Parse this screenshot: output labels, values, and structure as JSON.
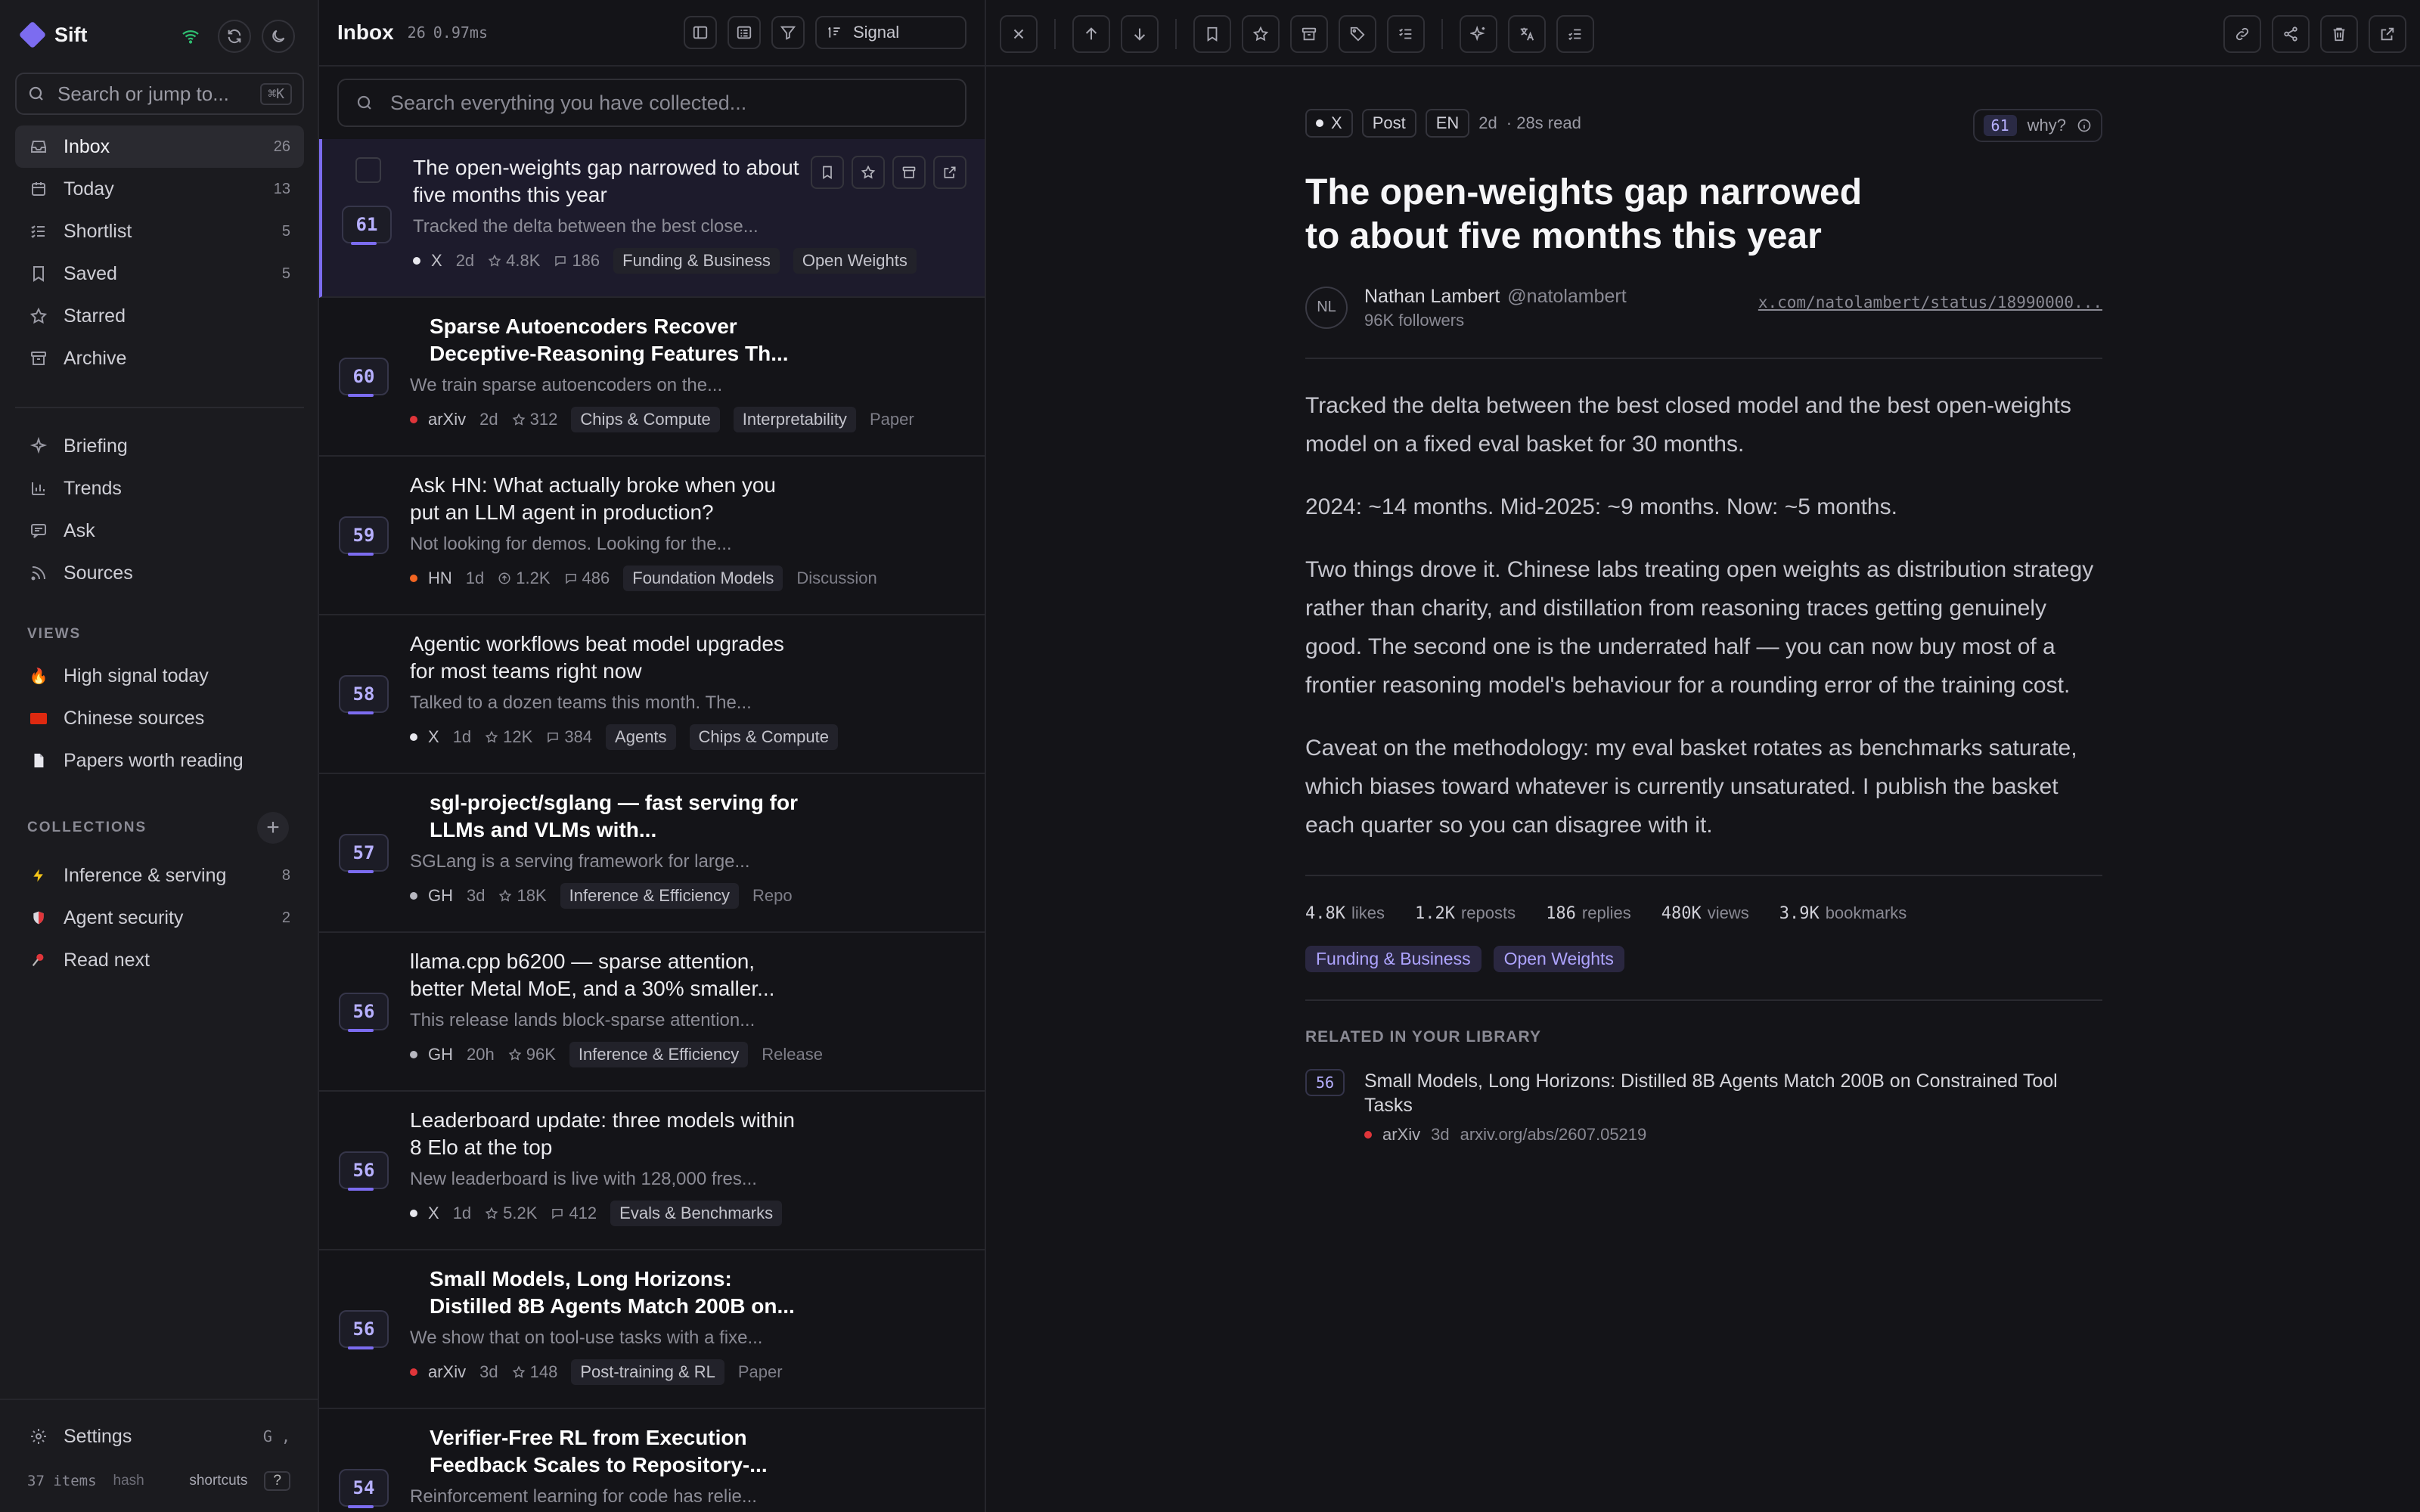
{
  "app": {
    "name": "Sift"
  },
  "sidebar": {
    "search_placeholder": "Search or jump to...",
    "search_kbd": "⌘K",
    "nav": [
      {
        "label": "Inbox",
        "count": "26",
        "icon": "inbox-icon"
      },
      {
        "label": "Today",
        "count": "13",
        "icon": "calendar-icon"
      },
      {
        "label": "Shortlist",
        "count": "5",
        "icon": "list-check-icon"
      },
      {
        "label": "Saved",
        "count": "5",
        "icon": "bookmark-icon"
      },
      {
        "label": "Starred",
        "count": "",
        "icon": "star-icon"
      },
      {
        "label": "Archive",
        "count": "",
        "icon": "archive-icon"
      }
    ],
    "tools": [
      {
        "label": "Briefing",
        "icon": "sparkle-icon"
      },
      {
        "label": "Trends",
        "icon": "bar-chart-icon"
      },
      {
        "label": "Ask",
        "icon": "chat-icon"
      },
      {
        "label": "Sources",
        "icon": "rss-icon"
      }
    ],
    "views_label": "VIEWS",
    "views": [
      {
        "label": "High signal today",
        "emoji": "🔥"
      },
      {
        "label": "Chinese sources",
        "emoji": "🇨🇳"
      },
      {
        "label": "Papers worth reading",
        "emoji": "📄"
      }
    ],
    "collections_label": "COLLECTIONS",
    "collections": [
      {
        "label": "Inference & serving",
        "count": "8",
        "emoji": "⚡"
      },
      {
        "label": "Agent security",
        "count": "2",
        "emoji": "🛡️"
      },
      {
        "label": "Read next",
        "count": "",
        "emoji": "📌"
      }
    ],
    "settings_label": "Settings",
    "settings_kbd": "G ,",
    "footer_items": "37 items",
    "footer_hash": "hash",
    "footer_shortcuts": "shortcuts",
    "footer_q": "?"
  },
  "list": {
    "title": "Inbox",
    "count": "26",
    "timing": "0.97ms",
    "signal_label": "Signal",
    "search_placeholder": "Search everything you have collected...",
    "items": [
      {
        "score": "61",
        "title": "The open-weights gap narrowed to about five months this year",
        "snippet": "Tracked the delta between the best close...",
        "source": "X",
        "src_color": "#e8e8ee",
        "age": "2d",
        "stat1": "4.8K",
        "stat2": "186",
        "tags": [
          "Funding & Business",
          "Open Weights"
        ],
        "kind": ""
      },
      {
        "score": "60",
        "title": "Sparse Autoencoders Recover Deceptive-Reasoning Features Th...",
        "snippet": "We train sparse autoencoders on the...",
        "source": "arXiv",
        "src_color": "#e0353a",
        "age": "2d",
        "stat1": "312",
        "stat2": "",
        "tags": [
          "Chips & Compute",
          "Interpretability"
        ],
        "kind": "Paper"
      },
      {
        "score": "59",
        "title": "Ask HN: What actually broke when you put an LLM agent in production?",
        "snippet": "Not looking for demos. Looking for the...",
        "source": "HN",
        "src_color": "#f26522",
        "age": "1d",
        "stat1": "1.2K",
        "stat2": "486",
        "tags": [
          "Foundation Models"
        ],
        "kind": "Discussion"
      },
      {
        "score": "58",
        "title": "Agentic workflows beat model upgrades for most teams right now",
        "snippet": "Talked to a dozen teams this month. The...",
        "source": "X",
        "src_color": "#e8e8ee",
        "age": "1d",
        "stat1": "12K",
        "stat2": "384",
        "tags": [
          "Agents",
          "Chips & Compute"
        ],
        "kind": ""
      },
      {
        "score": "57",
        "title": "sgl-project/sglang — fast serving for LLMs and VLMs with...",
        "snippet": "SGLang is a serving framework for large...",
        "source": "GH",
        "src_color": "#b8b8c0",
        "age": "3d",
        "stat1": "18K",
        "stat2": "",
        "tags": [
          "Inference & Efficiency"
        ],
        "kind": "Repo"
      },
      {
        "score": "56",
        "title": "llama.cpp b6200 — sparse attention, better Metal MoE, and a 30% smaller...",
        "snippet": "This release lands block-sparse attention...",
        "source": "GH",
        "src_color": "#b8b8c0",
        "age": "20h",
        "stat1": "96K",
        "stat2": "",
        "tags": [
          "Inference & Efficiency"
        ],
        "kind": "Release"
      },
      {
        "score": "56",
        "title": "Leaderboard update: three models within 8 Elo at the top",
        "snippet": "New leaderboard is live with 128,000 fres...",
        "source": "X",
        "src_color": "#e8e8ee",
        "age": "1d",
        "stat1": "5.2K",
        "stat2": "412",
        "tags": [
          "Evals & Benchmarks"
        ],
        "kind": ""
      },
      {
        "score": "56",
        "title": "Small Models, Long Horizons: Distilled 8B Agents Match 200B on...",
        "snippet": "We show that on tool-use tasks with a fixe...",
        "source": "arXiv",
        "src_color": "#e0353a",
        "age": "3d",
        "stat1": "148",
        "stat2": "",
        "tags": [
          "Post-training & RL"
        ],
        "kind": "Paper"
      },
      {
        "score": "54",
        "title": "Verifier-Free RL from Execution Feedback Scales to Repository-...",
        "snippet": "Reinforcement learning for code has relie...",
        "source": "arXiv",
        "src_color": "#e0353a",
        "age": "",
        "stat1": "",
        "stat2": "",
        "tags": [],
        "kind": ""
      }
    ]
  },
  "detail": {
    "source": "X",
    "type": "Post",
    "lang": "EN",
    "age": "2d",
    "read_time": "· 28s read",
    "score": "61",
    "why_label": "why?",
    "title": "The open-weights gap narrowed to about five months this year",
    "author_initials": "NL",
    "author_name": "Nathan Lambert",
    "author_handle": "@natolambert",
    "followers": "96K followers",
    "url": "x.com/natolambert/status/18990000...",
    "paragraphs": [
      "Tracked the delta between the best closed model and the best open-weights model on a fixed eval basket for 30 months.",
      "2024: ~14 months. Mid-2025: ~9 months. Now: ~5 months.",
      "Two things drove it. Chinese labs treating open weights as distribution strategy rather than charity, and distillation from reasoning traces getting genuinely good. The second one is the underrated half — you can now buy most of a frontier reasoning model's behaviour for a rounding error of the training cost.",
      "Caveat on the methodology: my eval basket rotates as benchmarks saturate, which biases toward whatever is currently unsaturated. I publish the basket each quarter so you can disagree with it."
    ],
    "stats": [
      {
        "value": "4.8K",
        "label": "likes"
      },
      {
        "value": "1.2K",
        "label": "reposts"
      },
      {
        "value": "186",
        "label": "replies"
      },
      {
        "value": "480K",
        "label": "views"
      },
      {
        "value": "3.9K",
        "label": "bookmarks"
      }
    ],
    "tags": [
      "Funding & Business",
      "Open Weights"
    ],
    "related_label": "RELATED IN YOUR LIBRARY",
    "related": {
      "score": "56",
      "title": "Small Models, Long Horizons: Distilled 8B Agents Match 200B on Constrained Tool Tasks",
      "source": "arXiv",
      "age": "3d",
      "url": "arxiv.org/abs/2607.05219"
    }
  },
  "colors": {
    "accent": "#7c6cf0",
    "background": "#141418",
    "sidebar": "#1b1b1f"
  }
}
